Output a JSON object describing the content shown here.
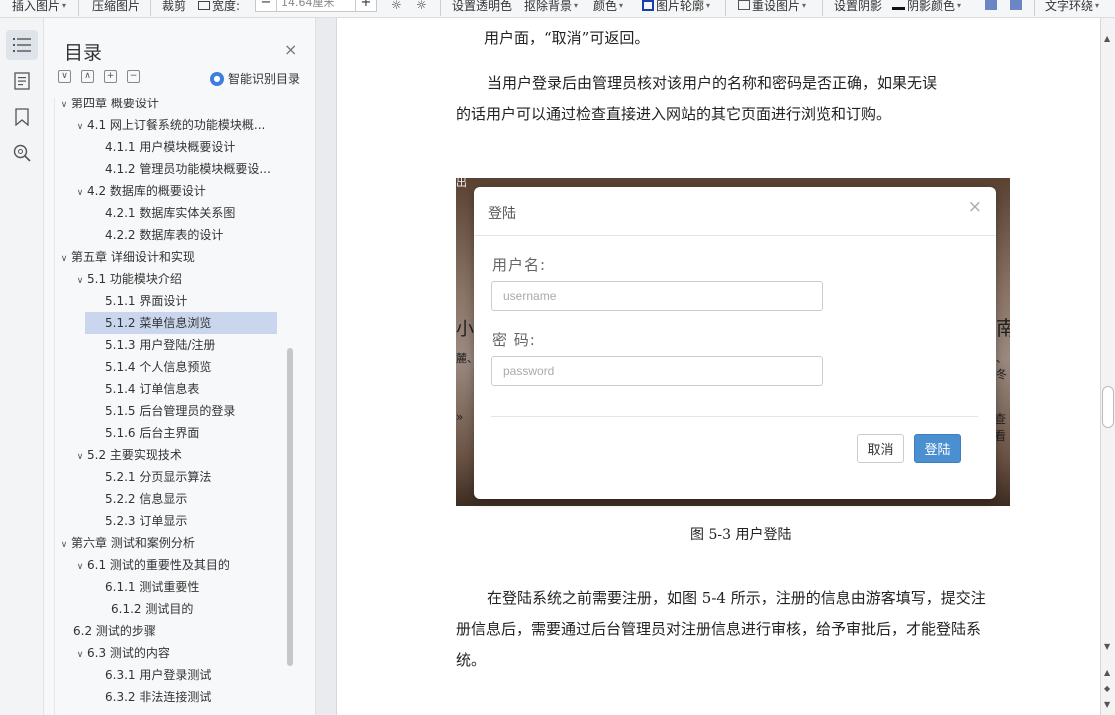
{
  "toolbar": {
    "items": [
      {
        "label": "插入图片",
        "caret": "▾"
      },
      {
        "label": "压缩图片"
      },
      {
        "label": "裁剪"
      },
      {
        "label": "宽度:"
      },
      {
        "label": "设置透明色"
      },
      {
        "label": "抠除背景",
        "caret": "▾"
      },
      {
        "label": "颜色",
        "caret": "▾"
      },
      {
        "label": "图片轮廓",
        "caret": "▾"
      },
      {
        "label": "重设图片",
        "caret": "▾"
      },
      {
        "label": "设置阴影"
      },
      {
        "label": "阴影颜色",
        "caret": "▾"
      },
      {
        "label": "文字环绕",
        "caret": "▾"
      }
    ],
    "width_value": "14.64厘米",
    "minus": "−",
    "plus": "+"
  },
  "toc": {
    "title": "目录",
    "close": "×",
    "smart_label": "智能识别目录",
    "items": [
      {
        "text": "第四章 概要设计",
        "level": 1,
        "expand": "∨"
      },
      {
        "text": "4.1 网上订餐系统的功能模块概...",
        "level": 2,
        "expand": "∨"
      },
      {
        "text": "4.1.1 用户模块概要设计",
        "level": 3
      },
      {
        "text": "4.1.2 管理员功能模块概要设...",
        "level": 3
      },
      {
        "text": "4.2 数据库的概要设计",
        "level": 2,
        "expand": "∨"
      },
      {
        "text": "4.2.1 数据库实体关系图",
        "level": 3
      },
      {
        "text": "4.2.2 数据库表的设计",
        "level": 3
      },
      {
        "text": "第五章  详细设计和实现",
        "level": 1,
        "expand": "∨"
      },
      {
        "text": "5.1 功能模块介绍",
        "level": 2,
        "expand": "∨"
      },
      {
        "text": "5.1.1 界面设计",
        "level": 3
      },
      {
        "text": "5.1.2  菜单信息浏览",
        "level": 3,
        "selected": true
      },
      {
        "text": "5.1.3  用户登陆/注册",
        "level": 3
      },
      {
        "text": "5.1.4  个人信息预览",
        "level": 3
      },
      {
        "text": "5.1.4  订单信息表",
        "level": 3
      },
      {
        "text": "5.1.5  后台管理员的登录",
        "level": 3
      },
      {
        "text": "5.1.6  后台主界面",
        "level": 3
      },
      {
        "text": "5.2 主要实现技术",
        "level": 2,
        "expand": "∨"
      },
      {
        "text": "5.2.1 分页显示算法",
        "level": 3
      },
      {
        "text": "5.2.2  信息显示",
        "level": 3
      },
      {
        "text": "5.2.3  订单显示",
        "level": 3
      },
      {
        "text": "第六章  测试和案例分析",
        "level": 1,
        "expand": "∨"
      },
      {
        "text": "6.1 测试的重要性及其目的",
        "level": 2,
        "expand": "∨"
      },
      {
        "text": "6.1.1 测试重要性",
        "level": 3
      },
      {
        "text": "6.1.2 测试目的",
        "level": 3,
        "indent_extra": true
      },
      {
        "text": "6.2 测试的步骤",
        "level": 2
      },
      {
        "text": "6.3 测试的内容",
        "level": 2,
        "expand": "∨"
      },
      {
        "text": "6.3.1 用户登录测试",
        "level": 3
      },
      {
        "text": "6.3.2 非法连接测试",
        "level": 3
      }
    ]
  },
  "doc": {
    "line1": "用户面，“取消”可返回。",
    "line2": "当用户登录后由管理员核对该用户的名称和密码是否正确，如果无误",
    "line3": "的话用户可以通过检查直接进入网站的其它页面进行浏览和订购。",
    "caption": "图 5-3  用户登陆",
    "para2_line1": "在登陆系统之前需要注册，如图 5-4 所示，注册的信息由游客填写，提交注",
    "para2_line2": "册信息后，需要通过后台管理员对注册信息进行审核，给予审批后，才能登陆系",
    "para2_line3": "统。"
  },
  "modal": {
    "title": "登陆",
    "close": "×",
    "username_label": "用户名:",
    "username_placeholder": "username",
    "password_label": "密  码:",
    "password_placeholder": "password",
    "cancel": "取消",
    "login": "登陆"
  },
  "screenshot_bg_text": {
    "left1": "出",
    "left2": "小",
    "right1": "南",
    "left3": "麓、",
    "right2": "、冬",
    "left4": "»",
    "right3": "查看"
  },
  "colors": {
    "accent": "#4a8fd0",
    "selected_row": "#c9d6ee",
    "smart_icon": "#3d7de0"
  }
}
